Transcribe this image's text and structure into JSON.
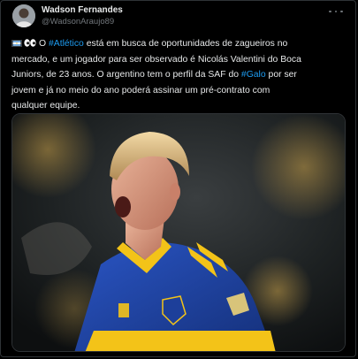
{
  "author": {
    "name": "Wadson Fernandes",
    "handle": "@WadsonAraujo89"
  },
  "tweet": {
    "line1_pre": "O ",
    "line1_tag": "#Atlético",
    "line1_post": " está em busca de oportunidades de zagueiros no",
    "line2": "mercado, e um jogador para ser observado é Nicolás Valentini do Boca",
    "line3_pre": "Juniors, de 23 anos. O argentino tem o perfil da SAF do ",
    "line3_tag": "#Galo",
    "line3_post": " por ser",
    "line4": "jovem e já no meio do ano poderá assinar um pré-contrato com",
    "line5": "qualquer equipe."
  },
  "colors": {
    "background": "#000000",
    "text": "#e7e9ea",
    "muted": "#71767b",
    "hashtag": "#1d9bf0",
    "border": "#2f3336",
    "jersey_blue": "#1d3f9a",
    "jersey_gold": "#f3c318"
  },
  "icons": {
    "more": "more-horizontal-icon",
    "flag": "argentina-flag-icon",
    "eyes": "eyes-emoji-icon"
  }
}
